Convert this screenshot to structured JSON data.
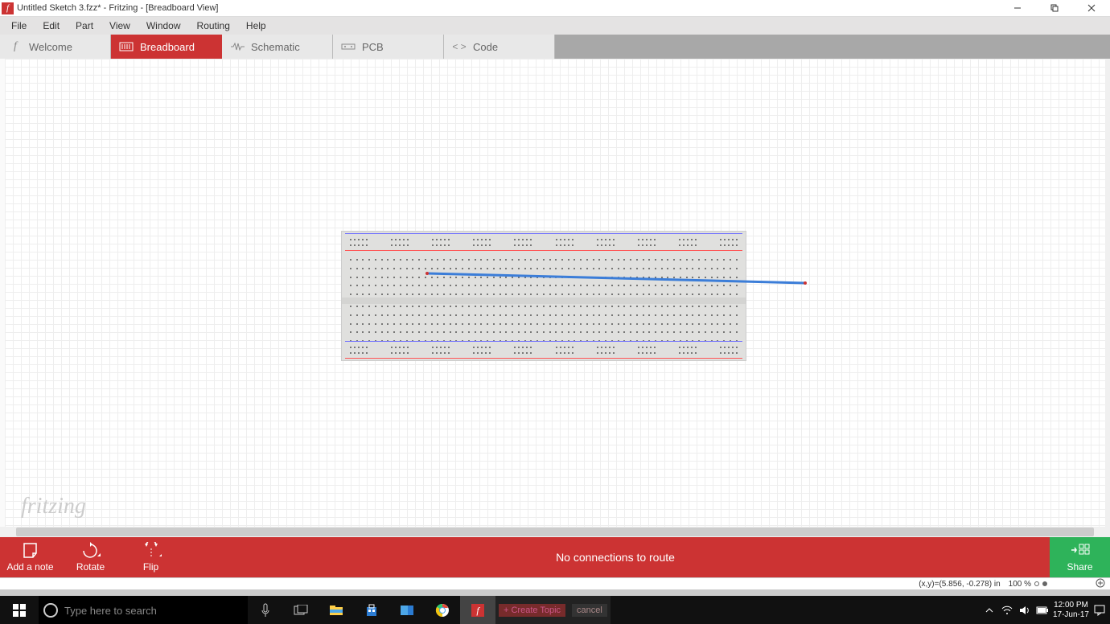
{
  "titlebar": {
    "app_icon_letter": "f",
    "title": "Untitled Sketch 3.fzz* - Fritzing - [Breadboard View]"
  },
  "menu": [
    "File",
    "Edit",
    "Part",
    "View",
    "Window",
    "Routing",
    "Help"
  ],
  "tabs": {
    "welcome": "Welcome",
    "breadboard": "Breadboard",
    "schematic": "Schematic",
    "pcb": "PCB",
    "code": "Code"
  },
  "canvas": {
    "watermark": "fritzing"
  },
  "bottombar": {
    "add_note": "Add a note",
    "rotate": "Rotate",
    "flip": "Flip",
    "status": "No connections to route",
    "share": "Share"
  },
  "statusline": {
    "coords": "(x,y)=(5.856, -0.278) in",
    "zoom": "100 %"
  },
  "taskbar": {
    "search_placeholder": "Type here to search",
    "forum_topic": "+ Create Topic",
    "forum_cancel": "cancel",
    "time": "12:00 PM",
    "date": "17-Jun-17"
  }
}
